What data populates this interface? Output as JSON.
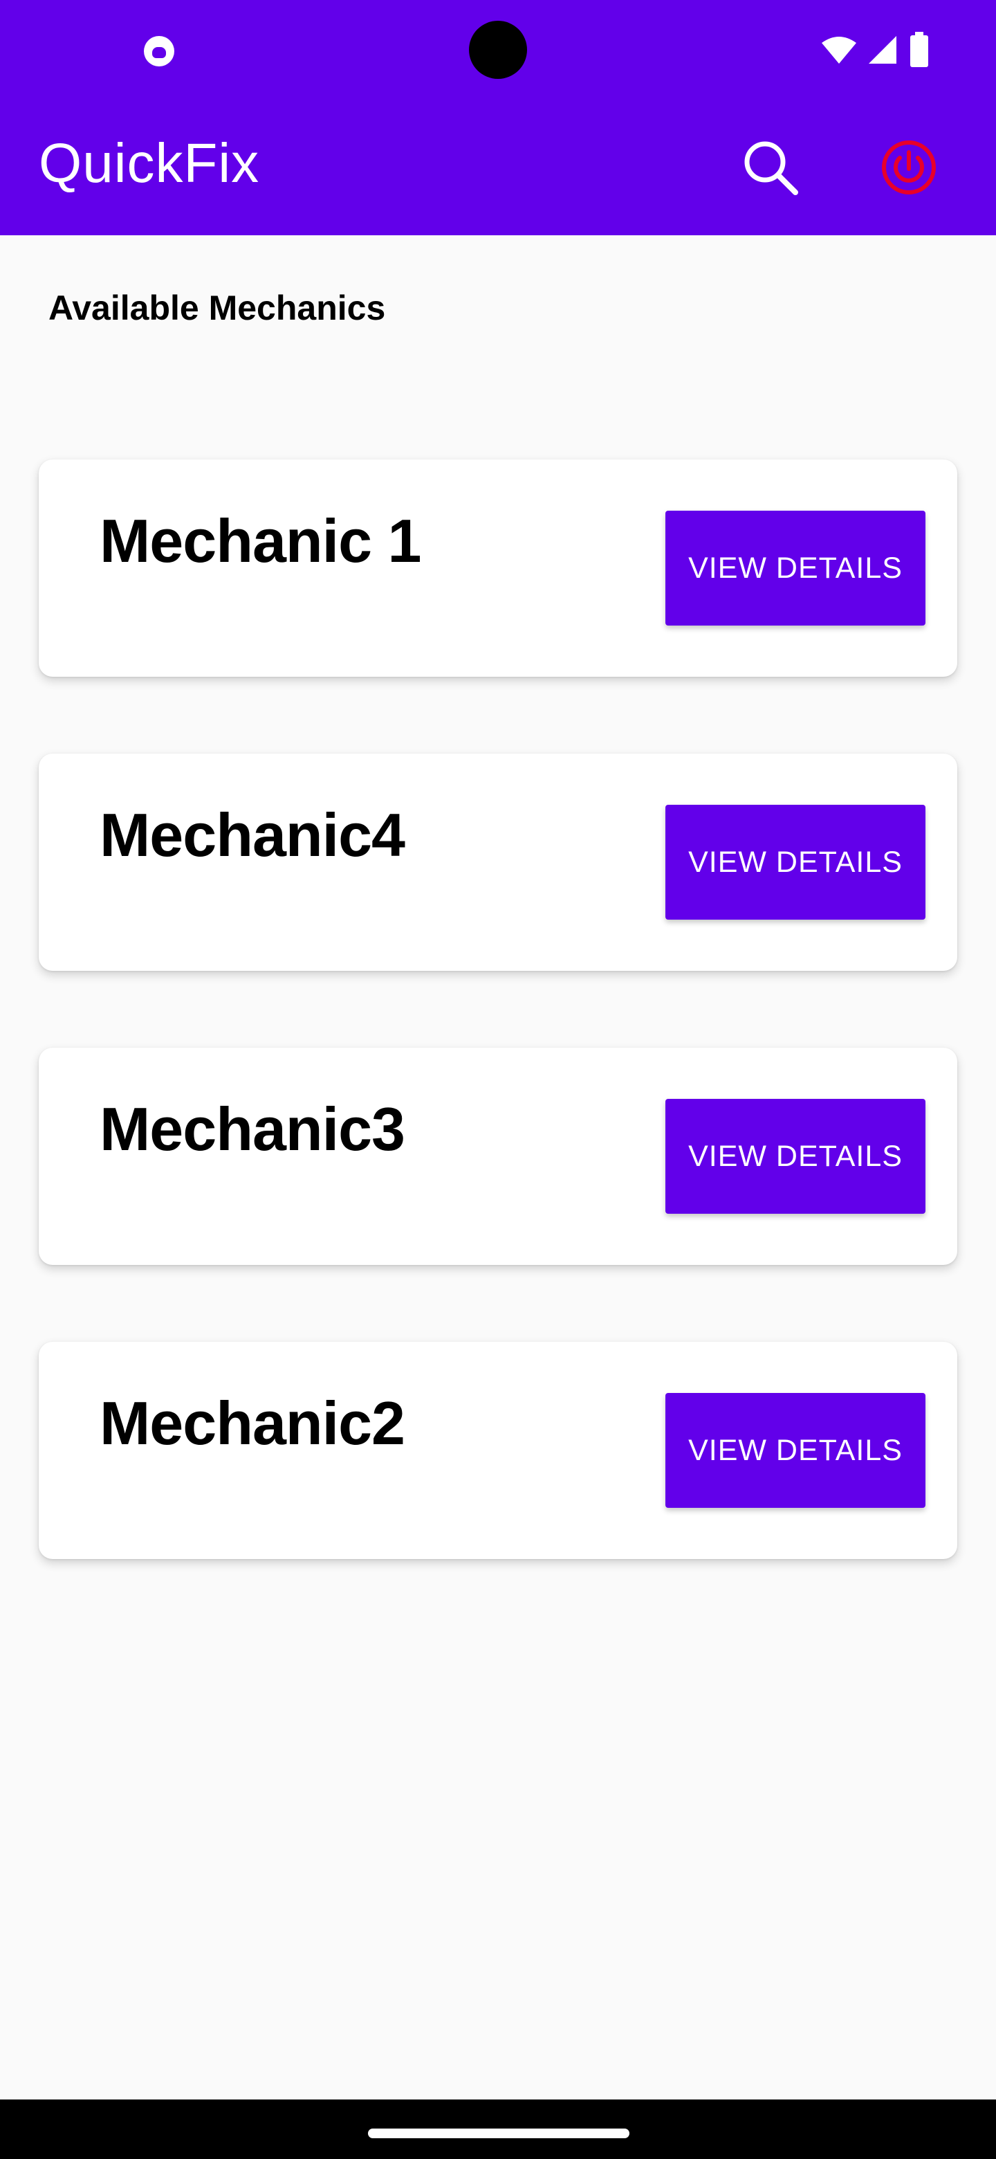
{
  "app": {
    "title": "QuickFix",
    "accent_color": "#6200ea",
    "power_color": "#e8002a"
  },
  "status_bar": {
    "icons": [
      "app-notification-icon",
      "wifi-icon",
      "signal-icon",
      "battery-icon"
    ]
  },
  "toolbar": {
    "search_icon": "search-icon",
    "power_icon": "power-icon"
  },
  "main": {
    "section_title": "Available Mechanics",
    "mechanics": [
      {
        "name": "Mechanic 1",
        "button_label": "VIEW DETAILS"
      },
      {
        "name": "Mechanic4",
        "button_label": "VIEW DETAILS"
      },
      {
        "name": "Mechanic3",
        "button_label": "VIEW DETAILS"
      },
      {
        "name": "Mechanic2",
        "button_label": "VIEW DETAILS"
      }
    ]
  }
}
